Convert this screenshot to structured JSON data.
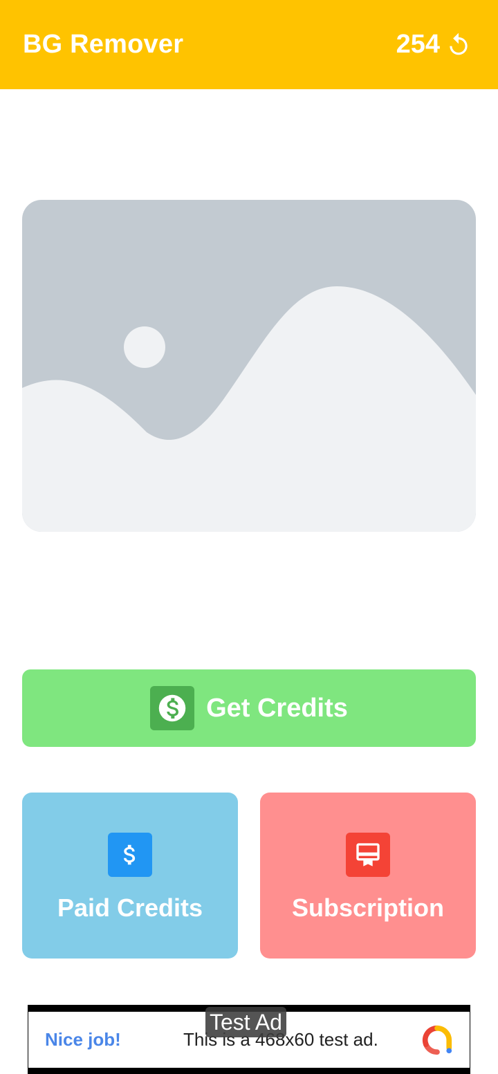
{
  "app_bar": {
    "title": "BG Remover",
    "credits": "254",
    "refresh_icon": "refresh-icon",
    "background_color": "#FFC300"
  },
  "image_picker": {
    "icon": "image-placeholder-icon"
  },
  "get_credits": {
    "label": "Get Credits",
    "icon": "dollar-circle-icon",
    "background_color": "#7FE67F"
  },
  "paid_credits": {
    "label": "Paid Credits",
    "icon": "dollar-icon",
    "background_color": "#82CCE8"
  },
  "subscription": {
    "label": "Subscription",
    "icon": "card-membership-icon",
    "background_color": "#FF8F8F"
  },
  "ad": {
    "badge": "Test Ad",
    "headline": "Nice job!",
    "body": "This is a 468x60 test ad.",
    "logo": "admob-logo-icon"
  }
}
